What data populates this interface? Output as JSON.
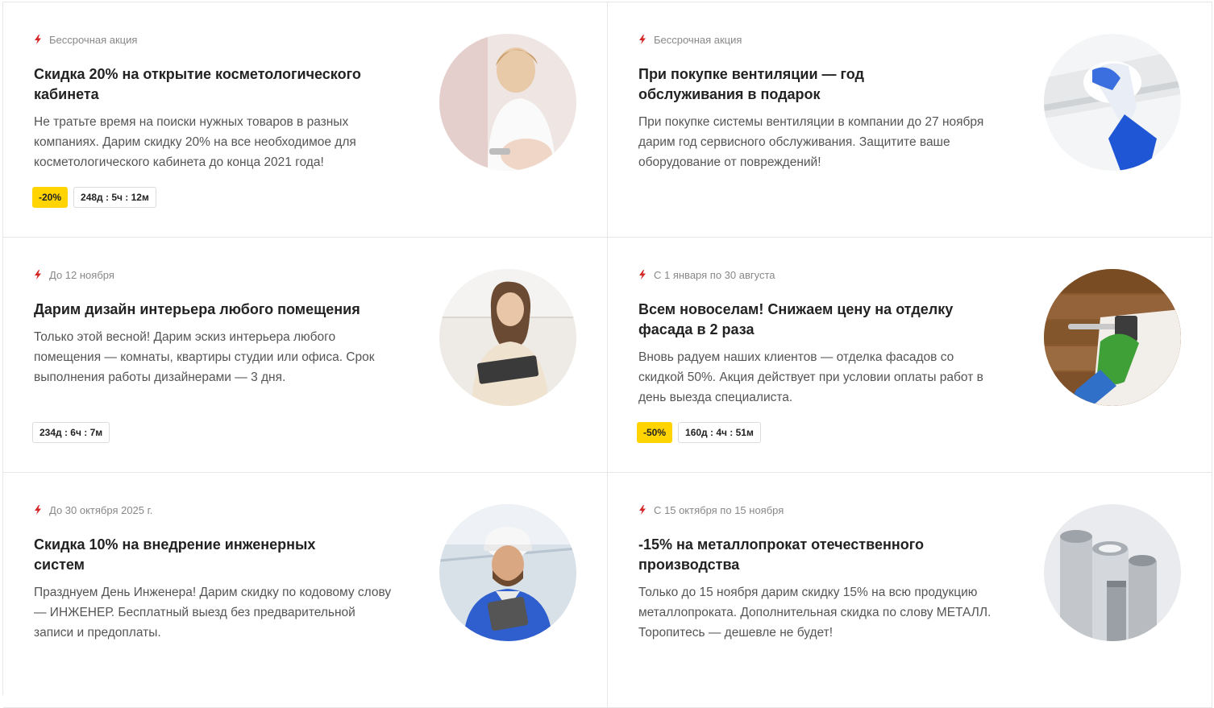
{
  "accent_color": "#d42626",
  "discount_color": "#ffd400",
  "promos": [
    {
      "period": "Бессрочная акция",
      "title": "Скидка 20% на открытие косметологического кабинета",
      "description": "Не тратьте время на поиски нужных товаров в разных компаниях. Дарим скидку 20% на все необходимое для косметологического кабинета до конца 2021 года!",
      "discount": "-20%",
      "timer": "248д : 5ч : 12м",
      "image_icon": "cosmetologist-photo"
    },
    {
      "period": "Бессрочная акция",
      "title": "При покупке вентиляции — год обслуживания в подарок",
      "description": "При покупке системы вентиляции в компании до 27 ноября дарим год сервисного обслуживания. Защитите ваше оборудование от повреждений!",
      "discount": "",
      "timer": "",
      "image_icon": "ventilation-cleaning-photo"
    },
    {
      "period": "До 12 ноября",
      "title": "Дарим дизайн интерьера любого помещения",
      "description": "Только этой весной! Дарим эскиз интерьера любого помещения — комнаты, квартиры студии или офиса. Срок выполнения работы дизайнерами — 3 дня.",
      "discount": "",
      "timer": "234д : 6ч : 7м",
      "image_icon": "designer-photo"
    },
    {
      "period": "С 1 января по 30 августа",
      "title": "Всем новоселам! Снижаем цену на отделку фасада в 2 раза",
      "description": "Вновь радуем наших клиентов — отделка фасадов со скидкой 50%. Акция действует при условии оплаты работ в день выезда специалиста.",
      "discount": "-50%",
      "timer": "160д : 4ч : 51м",
      "image_icon": "facade-painting-photo"
    },
    {
      "period": "До 30 октября 2025 г.",
      "title": "Скидка 10% на внедрение инженерных систем",
      "description": "Празднуем День Инженера! Дарим скидку по кодовому слову — ИНЖЕНЕР. Бесплатный выезд без предварительной записи и предоплаты.",
      "discount": "",
      "timer": "",
      "image_icon": "engineer-photo"
    },
    {
      "period": "С 15 октября по 15 ноября",
      "title": "-15% на металлопрокат отечественного производства",
      "description": "Только до 15 ноября дарим скидку 15% на всю продукцию металлопроката. Дополнительная скидка по слову МЕТАЛЛ. Торопитесь — дешевле не будет!",
      "discount": "",
      "timer": "",
      "image_icon": "metal-pipes-photo"
    }
  ]
}
